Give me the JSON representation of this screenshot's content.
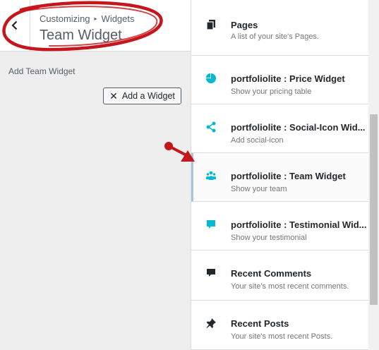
{
  "header": {
    "breadcrumb_root": "Customizing",
    "breadcrumb_section": "Widgets",
    "title": "Team Widget"
  },
  "sidebar": {
    "label": "Add Team Widget",
    "add_widget_label": "Add a Widget"
  },
  "widgets": [
    {
      "title": "Pages",
      "desc": "A list of your site's Pages.",
      "icon": "pages-icon",
      "icon_color": "#23282d"
    },
    {
      "title": "portfoliolite : Price Widget",
      "desc": "Show your pricing table",
      "icon": "pie-chart-icon",
      "icon_color": "#00b9d3"
    },
    {
      "title": "portfoliolite : Social-Icon Wid...",
      "desc": "Add social-icon",
      "icon": "share-icon",
      "icon_color": "#00b9d3"
    },
    {
      "title": "portfoliolite : Team Widget",
      "desc": "Show your team",
      "icon": "team-icon",
      "icon_color": "#00b9d3"
    },
    {
      "title": "portfoliolite : Testimonial Wid...",
      "desc": "Show your testimonial",
      "icon": "testimonial-icon",
      "icon_color": "#00b9d3"
    },
    {
      "title": "Recent Comments",
      "desc": "Your site's most recent comments.",
      "icon": "comment-icon",
      "icon_color": "#23282d"
    },
    {
      "title": "Recent Posts",
      "desc": "Your site's most recent Posts.",
      "icon": "pin-icon",
      "icon_color": "#23282d"
    }
  ],
  "colors": {
    "annotation_red": "#c4161c",
    "accent_teal": "#00b9d3",
    "selected_border": "#a9c4d9"
  }
}
